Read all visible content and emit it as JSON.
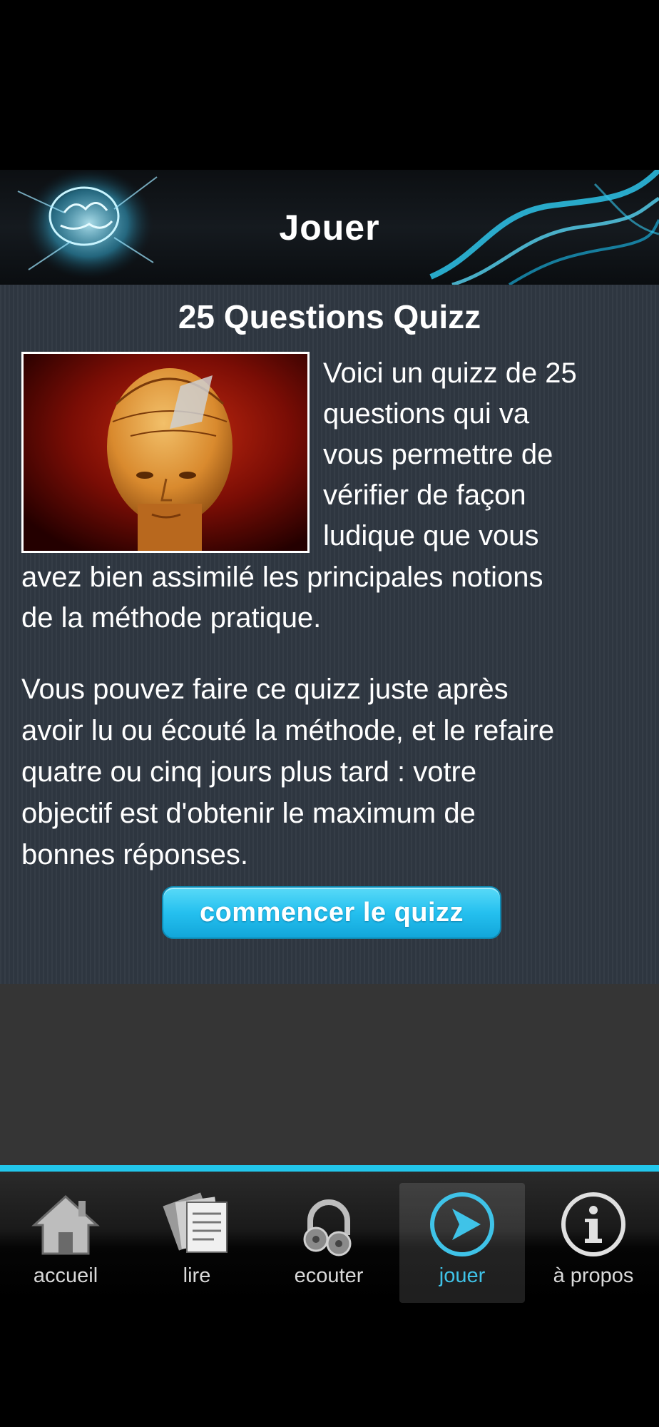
{
  "header": {
    "title": "Jouer"
  },
  "quiz": {
    "title": "25 Questions Quizz",
    "intro_lines": [
      "Voici un quizz de 25",
      "questions qui va",
      "vous permettre de",
      "vérifier de façon",
      "ludique que vous"
    ],
    "intro_rest_lines": [
      "avez bien assimilé les principales notions",
      "de la méthode pratique."
    ],
    "body_lines": [
      "Vous pouvez faire ce quizz juste après",
      "avoir lu ou écouté la méthode, et le refaire",
      "quatre ou cinq jours plus tard : votre",
      "objectif est d'obtenir le maximum de",
      "bonnes réponses."
    ],
    "start_button": "commencer le quizz"
  },
  "tabs": [
    {
      "label": "accueil",
      "icon": "home-icon",
      "active": false
    },
    {
      "label": "lire",
      "icon": "papers-icon",
      "active": false
    },
    {
      "label": "ecouter",
      "icon": "headphones-icon",
      "active": false
    },
    {
      "label": "jouer",
      "icon": "play-icon",
      "active": true
    },
    {
      "label": "à propos",
      "icon": "info-icon",
      "active": false
    }
  ],
  "colors": {
    "accent": "#22c7ec",
    "button": "#25c0ef",
    "content_bg": "#2e3640"
  }
}
